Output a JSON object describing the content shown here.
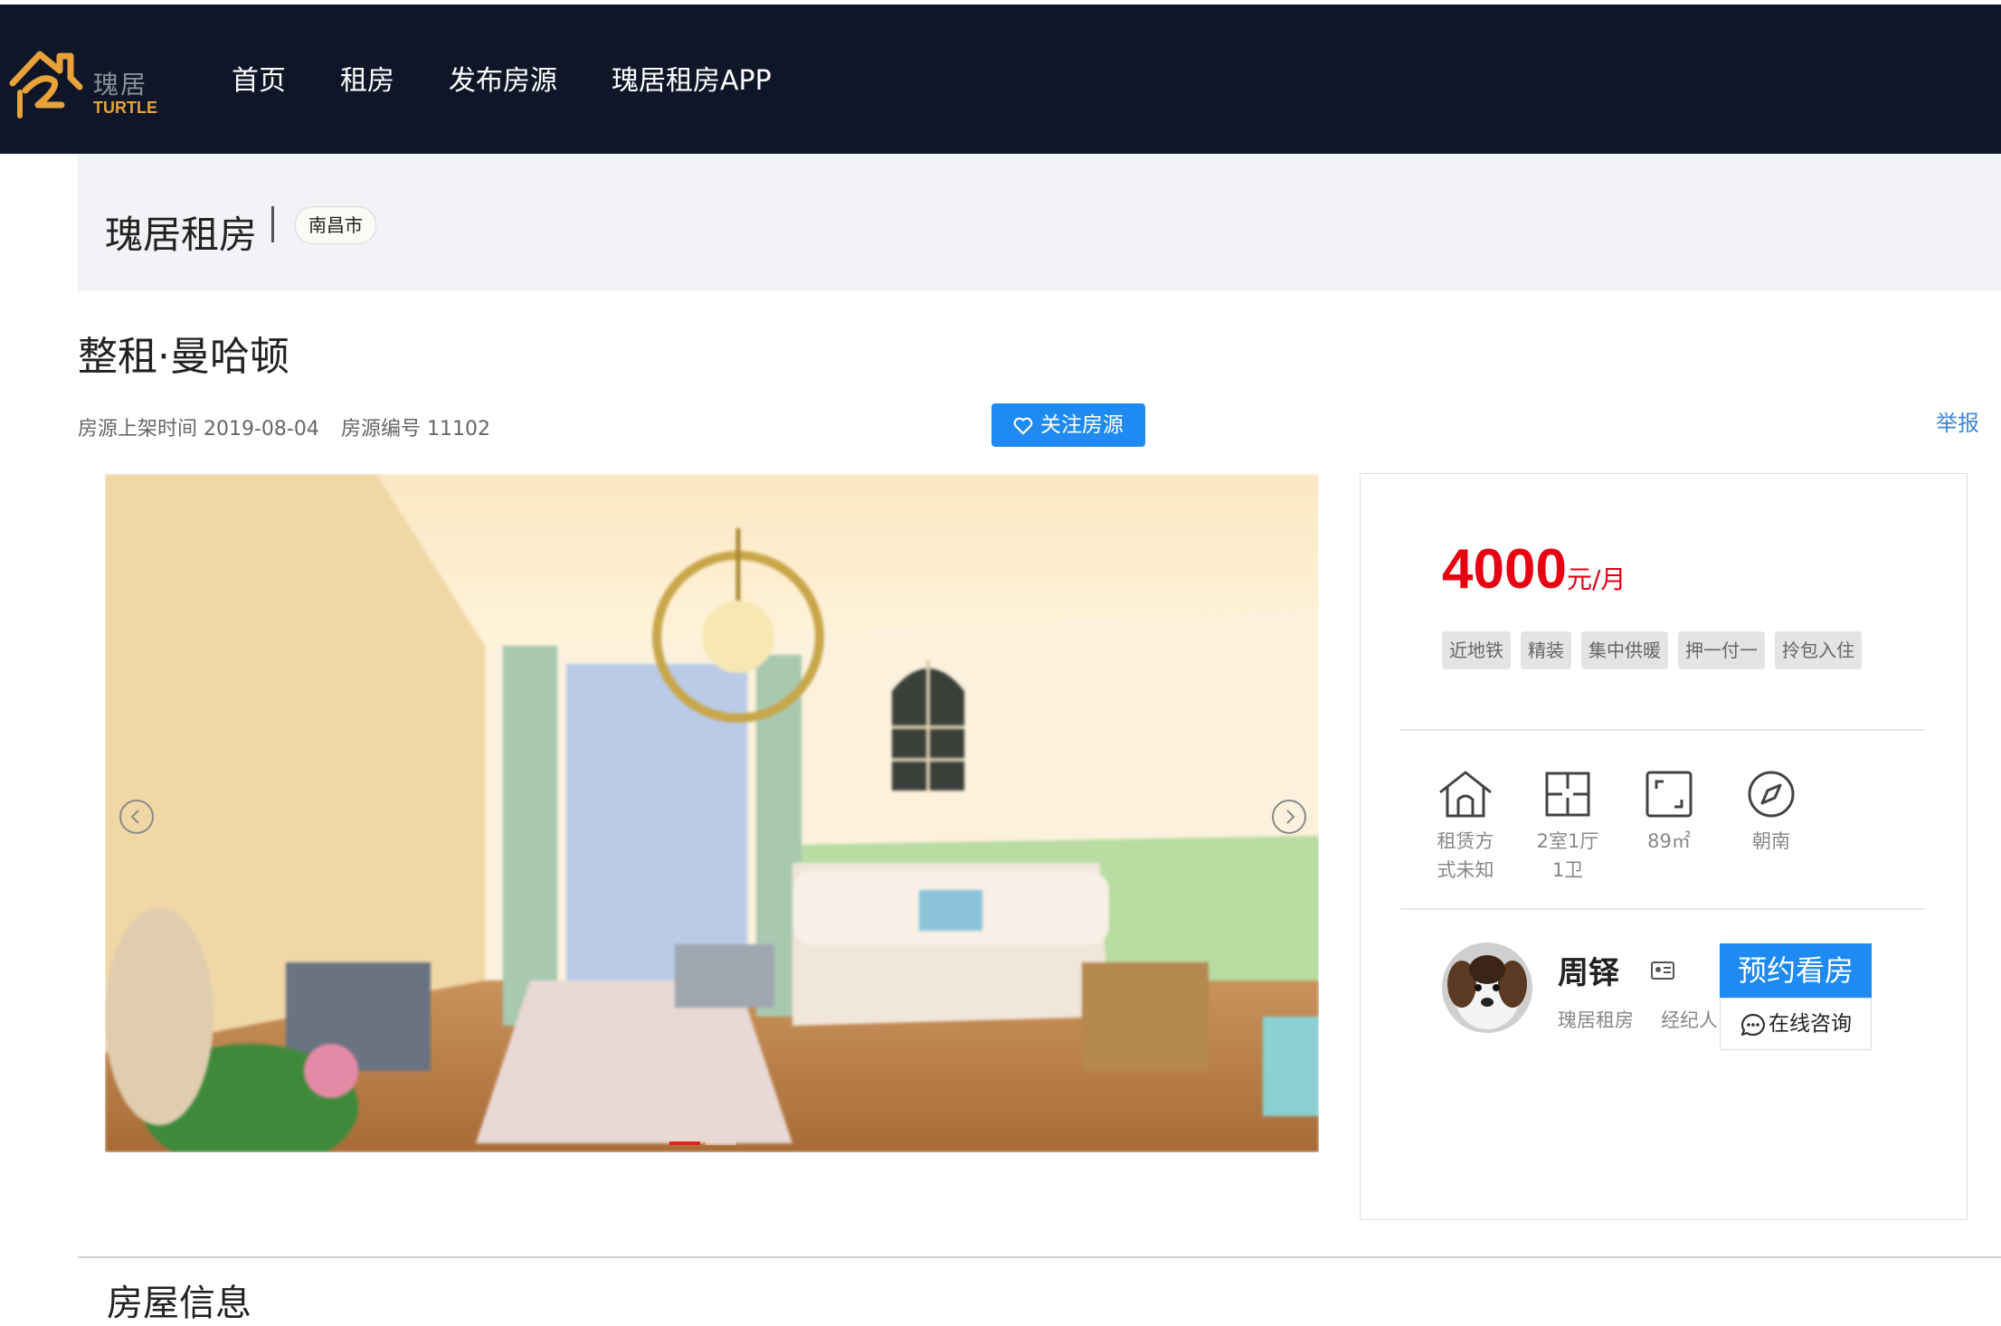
{
  "nav": {
    "logo": {
      "cn": "瑰居",
      "en": "TURTLE"
    },
    "links": [
      "首页",
      "租房",
      "发布房源",
      "瑰居租房APP"
    ]
  },
  "breadcrumb": {
    "title": "瑰居租房",
    "city": "南昌市"
  },
  "house": {
    "title": "整租·曼哈顿",
    "listed_label": "房源上架时间 2019-08-04",
    "number_label": "房源编号 11102",
    "follow_label": "关注房源",
    "report_label": "举报"
  },
  "carousel": {
    "slide_count": 2,
    "active_index": 0
  },
  "price": {
    "amount": "4000",
    "unit": "元/月"
  },
  "tags": [
    "近地铁",
    "精装",
    "集中供暖",
    "押一付一",
    "拎包入住"
  ],
  "features": [
    {
      "icon": "house-icon",
      "line1": "租赁方",
      "line2": "式未知"
    },
    {
      "icon": "floorplan-icon",
      "line1": "2室1厅",
      "line2": "1卫"
    },
    {
      "icon": "area-icon",
      "line1": "89㎡",
      "line2": ""
    },
    {
      "icon": "compass-icon",
      "line1": "朝南",
      "line2": ""
    }
  ],
  "agent": {
    "name": "周铎",
    "company": "瑰居租房",
    "role": "经纪人",
    "book_label": "预约看房",
    "consult_label": "在线咨询"
  },
  "section": {
    "title": "房屋信息"
  },
  "colors": {
    "nav_bg": "#0e1628",
    "accent": "#1f8bf2",
    "price": "#e60012",
    "logo": "#e8a23a"
  }
}
